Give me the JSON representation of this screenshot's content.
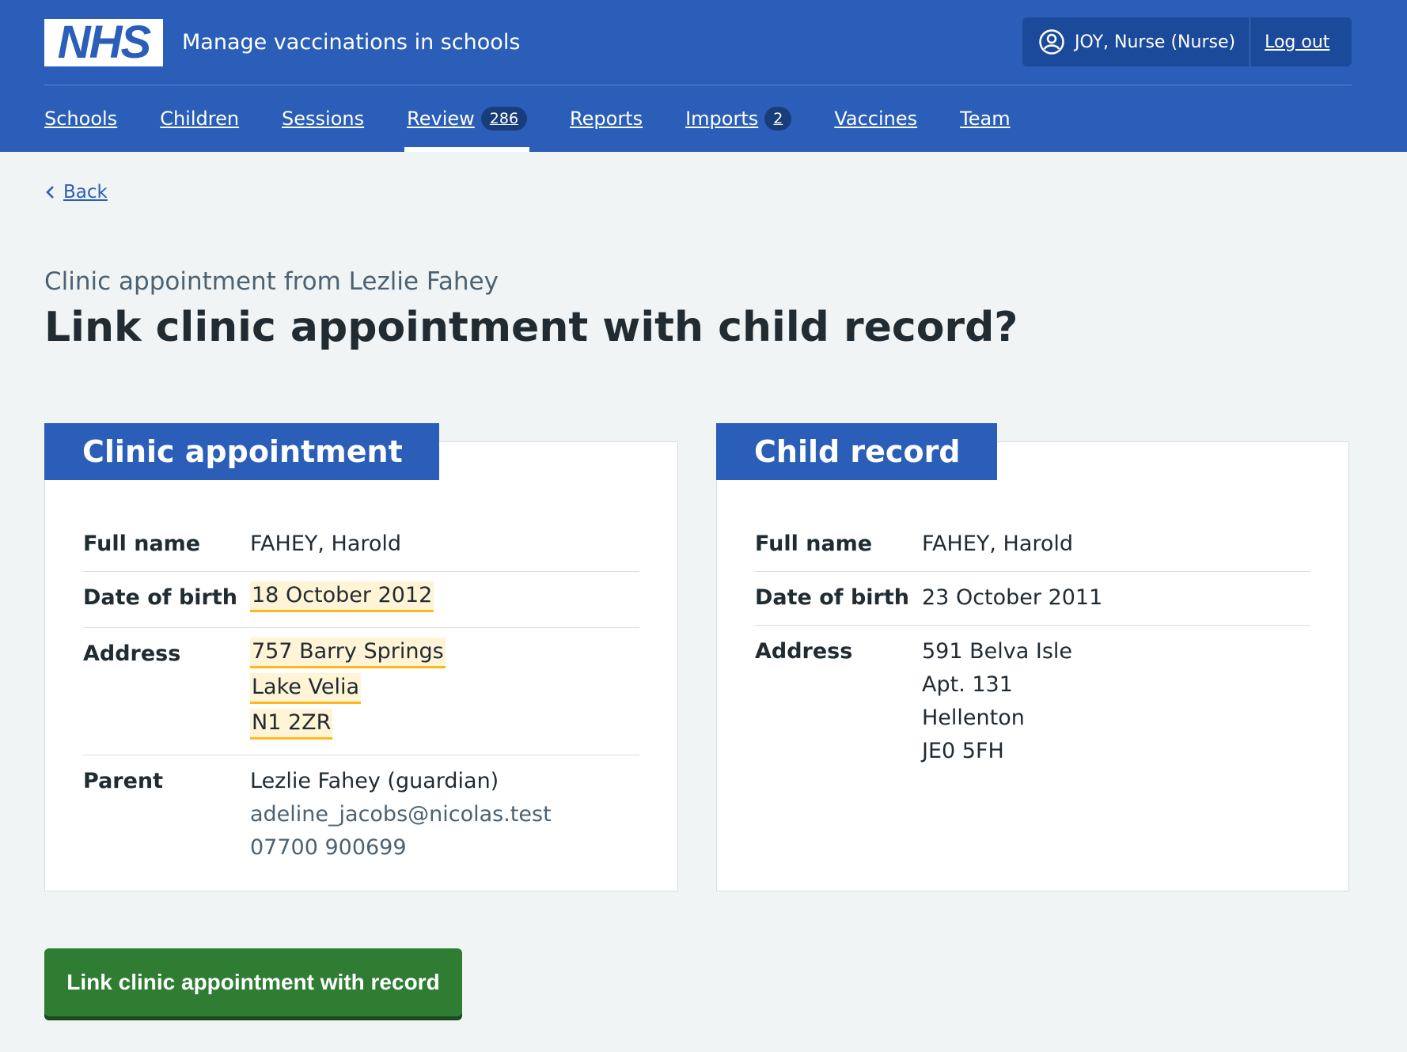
{
  "header": {
    "logo_text": "NHS",
    "service_name": "Manage vaccinations in schools",
    "user": "JOY, Nurse (Nurse)",
    "logout": "Log out"
  },
  "nav": [
    {
      "label": "Schools",
      "badge": null,
      "active": false
    },
    {
      "label": "Children",
      "badge": null,
      "active": false
    },
    {
      "label": "Sessions",
      "badge": null,
      "active": false
    },
    {
      "label": "Review",
      "badge": "286",
      "active": true
    },
    {
      "label": "Reports",
      "badge": null,
      "active": false
    },
    {
      "label": "Imports",
      "badge": "2",
      "active": false
    },
    {
      "label": "Vaccines",
      "badge": null,
      "active": false
    },
    {
      "label": "Team",
      "badge": null,
      "active": false
    }
  ],
  "back_label": "Back",
  "caption": "Clinic appointment from Lezlie Fahey",
  "title": "Link clinic appointment with child record?",
  "clinic_card": {
    "heading": "Clinic appointment",
    "full_name_label": "Full name",
    "full_name": "FAHEY, Harold",
    "dob_label": "Date of birth",
    "dob": "18 October 2012",
    "address_label": "Address",
    "address": [
      "757 Barry Springs",
      "Lake Velia",
      "N1 2ZR"
    ],
    "parent_label": "Parent",
    "parent_name": "Lezlie Fahey (guardian)",
    "parent_email": "adeline_jacobs@nicolas.test",
    "parent_phone": "07700 900699"
  },
  "child_card": {
    "heading": "Child record",
    "full_name_label": "Full name",
    "full_name": "FAHEY, Harold",
    "dob_label": "Date of birth",
    "dob": "23 October 2011",
    "address_label": "Address",
    "address": [
      "591 Belva Isle",
      "Apt. 131",
      "Hellenton",
      "JE0 5FH"
    ]
  },
  "link_button": "Link clinic appointment with record",
  "colors": {
    "nhs_blue": "#2a5eb8",
    "highlight": "#fff4d6",
    "highlight_border": "#ffb81c",
    "button_green": "#2e7d32"
  }
}
